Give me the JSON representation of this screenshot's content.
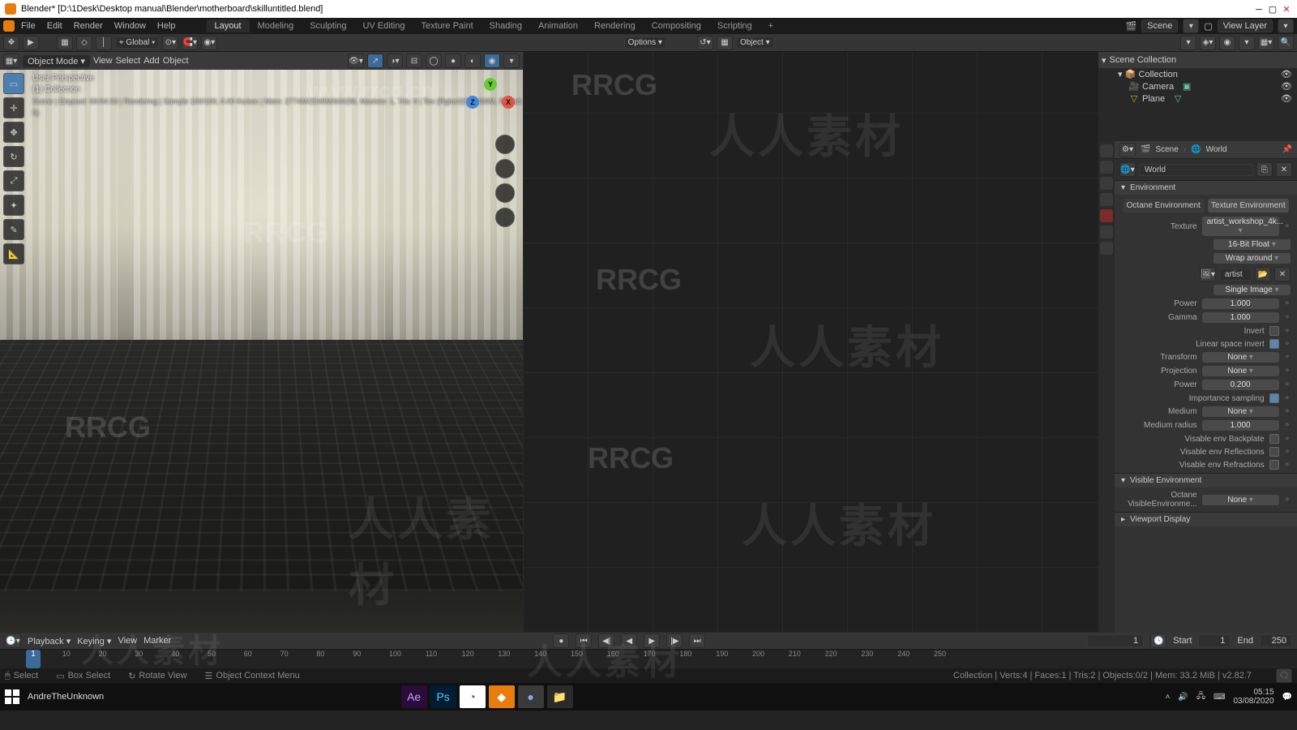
{
  "titlebar": {
    "icon": "blender",
    "text": "Blender* [D:\\1Desk\\Desktop manual\\Blender\\motherboard\\skilluntitled.blend]"
  },
  "menu": [
    "File",
    "Edit",
    "Render",
    "Window",
    "Help"
  ],
  "workspaces": [
    "Layout",
    "Modeling",
    "Sculpting",
    "UV Editing",
    "Texture Paint",
    "Shading",
    "Animation",
    "Rendering",
    "Compositing",
    "Scripting"
  ],
  "workspace_active": "Layout",
  "topbar_right": {
    "scene_icon": "🎬",
    "scene": "Scene",
    "layer_icon": "▢",
    "layer": "View Layer"
  },
  "tool_settings": {
    "orientation": "Global",
    "options": "Options",
    "object_dd": "Object"
  },
  "viewport_header": {
    "mode": "Object Mode",
    "menus": [
      "View",
      "Select",
      "Add",
      "Object"
    ]
  },
  "overlay": {
    "l1": "User Perspective",
    "l2": "(1) Collection",
    "l3": "Scene | Elapsed: 00:04.93 | Rendering | Sample 100/100, 0.00 Ks/sec | Mem: 2774M/2548M/6442M, Meshes: 1, Tris: 0 | Tex (Rgba32f: 1/489M, Rgba8: 0)"
  },
  "gizmos": {
    "x": "X",
    "y": "Y",
    "z": "Z"
  },
  "outliner": {
    "title": "Scene Collection",
    "items": [
      {
        "name": "Collection",
        "level": 1,
        "icon": "📦"
      },
      {
        "name": "Camera",
        "level": 2,
        "icon": "🎥"
      },
      {
        "name": "Plane",
        "level": 2,
        "icon": "▽"
      }
    ]
  },
  "props_header": {
    "scene": "Scene",
    "world": "World"
  },
  "props_crumb": {
    "icon": "🌐",
    "text": "World"
  },
  "panel_env": "Environment",
  "env_tabs": [
    "Octane Environment",
    "Texture Environment"
  ],
  "env_tab_active": "Texture Environment",
  "env_rows": {
    "texture": {
      "label": "Texture",
      "value": "artist_workshop_4k..."
    },
    "bit": {
      "value": "16-Bit Float"
    },
    "wrap": {
      "value": "Wrap around"
    },
    "img_field": "artist",
    "single": {
      "value": "Single Image"
    },
    "power": {
      "label": "Power",
      "value": "1.000"
    },
    "gamma": {
      "label": "Gamma",
      "value": "1.000"
    },
    "invert": {
      "label": "Invert",
      "checked": false
    },
    "lsi": {
      "label": "Linear space invert",
      "checked": true
    },
    "transform": {
      "label": "Transform",
      "value": "None"
    },
    "projection": {
      "label": "Projection",
      "value": "None"
    },
    "power2": {
      "label": "Power",
      "value": "0.200"
    },
    "imp": {
      "label": "Importance sampling",
      "checked": true
    },
    "medium": {
      "label": "Medium",
      "value": "None"
    },
    "medrad": {
      "label": "Medium radius",
      "value": "1.000"
    },
    "back": {
      "label": "Visable env Backplate",
      "checked": false
    },
    "refl": {
      "label": "Visable env Reflections",
      "checked": false
    },
    "refr": {
      "label": "Visable env Refractions",
      "checked": false
    }
  },
  "panel_visenv": "Visible Environment",
  "visenv_row": {
    "label": "Octane VisibleEnvironme...",
    "value": "None"
  },
  "panel_vdisplay": "Viewport Display",
  "timeline": {
    "menus": [
      "Playback",
      "Keying",
      "View",
      "Marker"
    ],
    "start_label": "Start",
    "start": "1",
    "end_label": "End",
    "end": "250",
    "current": "1",
    "cursor": "1",
    "ticks": [
      10,
      20,
      30,
      40,
      50,
      60,
      70,
      80,
      90,
      100,
      110,
      120,
      130,
      140,
      150,
      160,
      170,
      180,
      190,
      200,
      210,
      220,
      230,
      240,
      250
    ]
  },
  "status": {
    "left": [
      {
        "icon": "🖱",
        "label": "Select"
      },
      {
        "icon": "▭",
        "label": "Box Select"
      },
      {
        "icon": "↻",
        "label": "Rotate View"
      },
      {
        "icon": "☰",
        "label": "Object Context Menu"
      }
    ],
    "right": "Collection | Verts:4 | Faces:1 | Tris:2 | Objects:0/2 | Mem: 33.2 MiB | v2.82.7"
  },
  "taskbar": {
    "user": "AndreTheUnknown",
    "apps": [
      {
        "name": "after-effects",
        "label": "Ae",
        "bg": "#2a0b3a",
        "color": "#c9a0ff"
      },
      {
        "name": "photoshop",
        "label": "Ps",
        "bg": "#001d33",
        "color": "#5ac8fa"
      },
      {
        "name": "chrome",
        "label": "◔",
        "bg": "#fff",
        "color": "#555"
      },
      {
        "name": "blender",
        "label": "◆",
        "bg": "#e87d0d",
        "color": "#fff"
      },
      {
        "name": "app5",
        "label": "●",
        "bg": "#3a3a3a",
        "color": "#8ad"
      },
      {
        "name": "explorer",
        "label": "📁",
        "bg": "#2a2a2a",
        "color": "#e8c060"
      }
    ],
    "time": "05:15",
    "date": "03/08/2020"
  },
  "watermarks": {
    "url": "www.rrcg.cn",
    "brand": "RRCG",
    "cjk": "人人素材"
  }
}
